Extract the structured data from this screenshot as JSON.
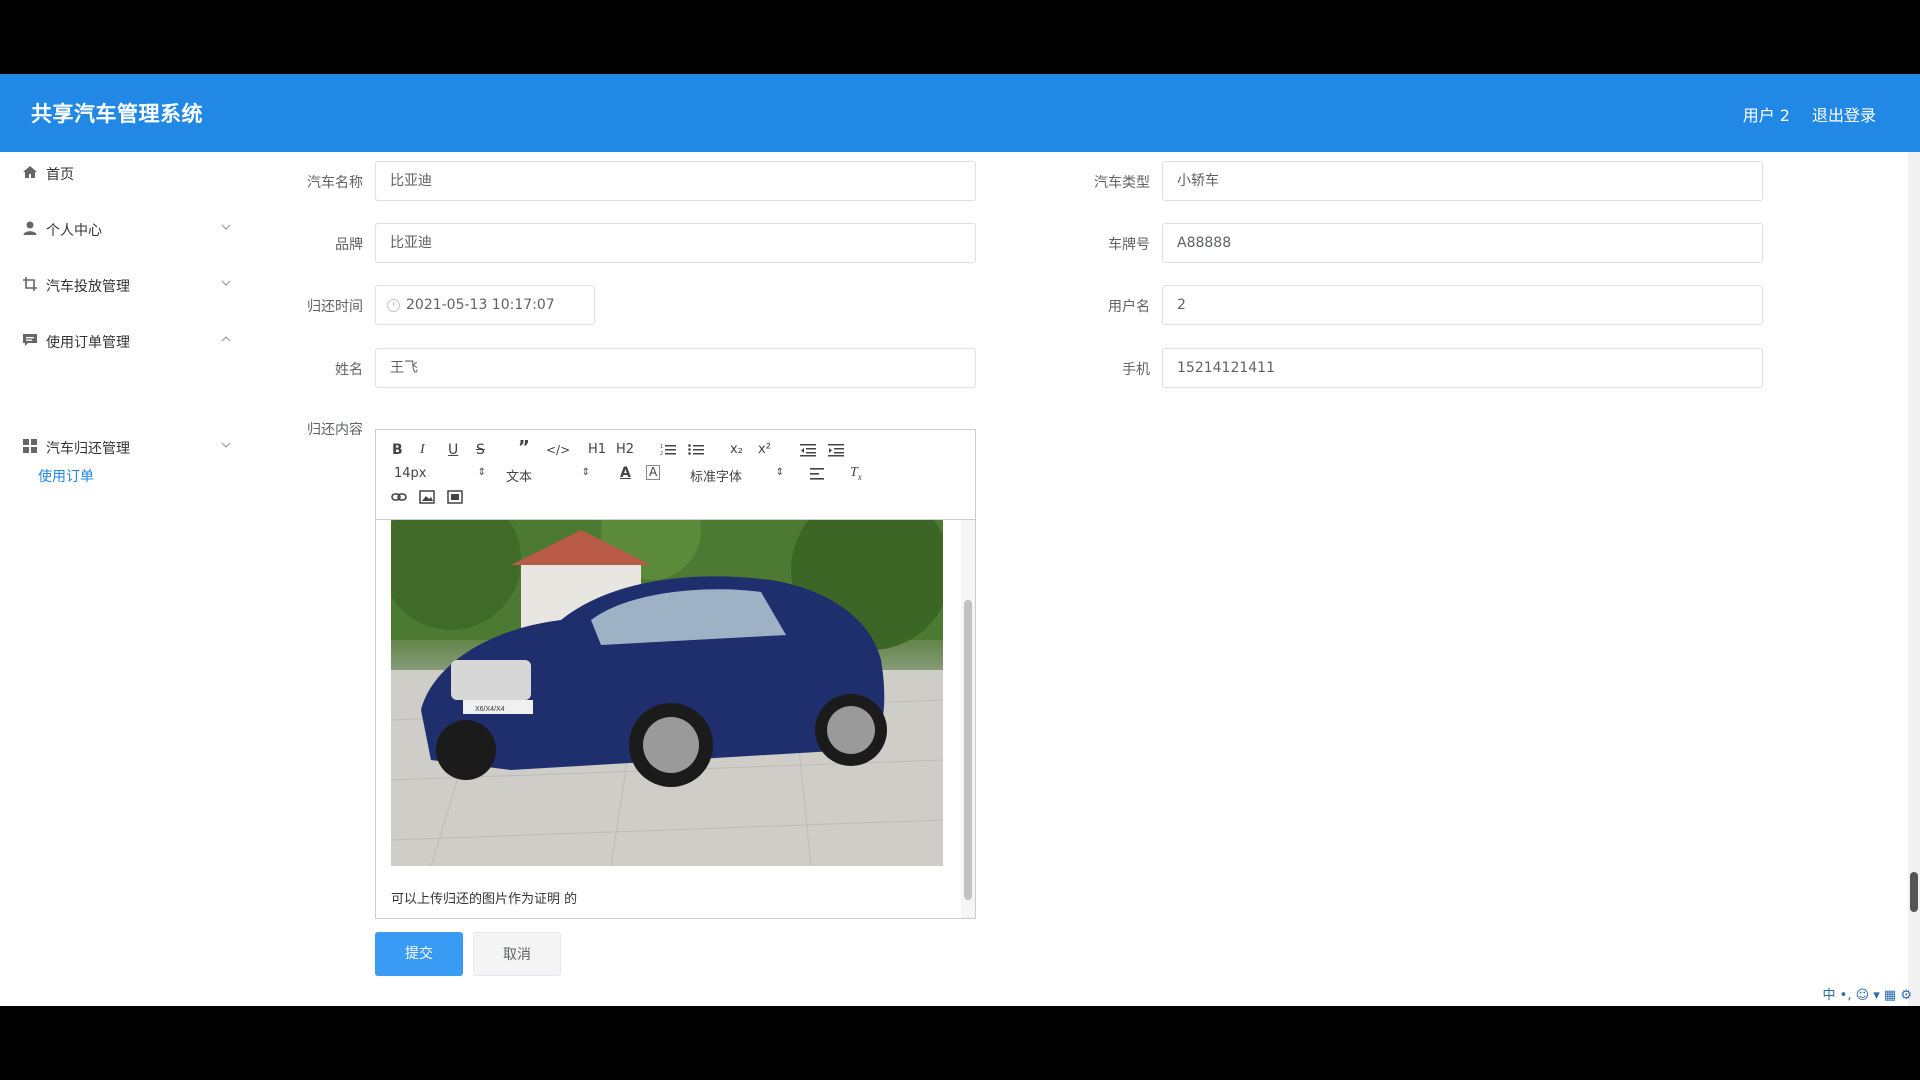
{
  "header": {
    "title": "共享汽车管理系统",
    "user": "用户 2",
    "logout": "退出登录"
  },
  "sidebar": {
    "items": [
      {
        "label": "首页",
        "icon": "home-icon"
      },
      {
        "label": "个人中心",
        "icon": "user-icon"
      },
      {
        "label": "汽车投放管理",
        "icon": "crop-icon"
      },
      {
        "label": "使用订单管理",
        "icon": "comment-icon"
      },
      {
        "label": "汽车归还管理",
        "icon": "grid-icon"
      }
    ],
    "sub_item": "使用订单"
  },
  "form": {
    "car_name": {
      "label": "汽车名称",
      "value": "比亚迪"
    },
    "car_type": {
      "label": "汽车类型",
      "value": "小轿车"
    },
    "brand": {
      "label": "品牌",
      "value": "比亚迪"
    },
    "plate": {
      "label": "车牌号",
      "value": "A88888"
    },
    "return_time": {
      "label": "归还时间",
      "value": "2021-05-13 10:17:07"
    },
    "username": {
      "label": "用户名",
      "value": "2"
    },
    "name": {
      "label": "姓名",
      "value": "王飞"
    },
    "phone": {
      "label": "手机",
      "value": "15214121411"
    },
    "content": {
      "label": "归还内容",
      "text": "可以上传归还的图片作为证明 的"
    }
  },
  "editor": {
    "font_size": "14px",
    "block_type": "文本",
    "font_family": "标准字体",
    "h1": "H1",
    "h2": "H2",
    "plate_badge": "X6/X4/X4"
  },
  "buttons": {
    "submit": "提交",
    "cancel": "取消"
  },
  "ime": "中 •, ☺ ▾ ▦ ⚙"
}
